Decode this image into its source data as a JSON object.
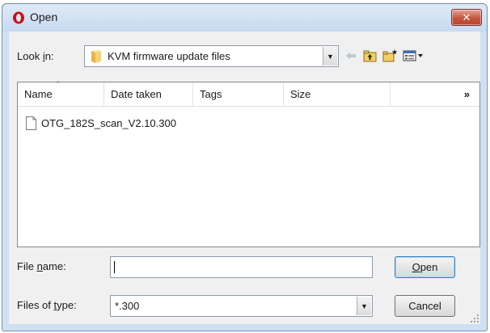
{
  "window": {
    "title": "Open",
    "close_glyph": "✕",
    "app_icon": "opera-logo-icon",
    "colors": {
      "title_bg": "#cfe0f3",
      "close_bg": "#c6553f",
      "accent_logo": "#cc0f16"
    }
  },
  "lookin": {
    "label_pre": "Look ",
    "label_u": "i",
    "label_post": "n:",
    "value": "KVM firmware update files",
    "icon": "folder-icon"
  },
  "toolbar": {
    "back_icon": "back-arrow-icon",
    "up_icon": "up-folder-icon",
    "new_folder_icon": "new-folder-icon",
    "view_menu_icon": "view-menu-icon"
  },
  "columns": [
    "Name",
    "Date taken",
    "Tags",
    "Size"
  ],
  "more_columns_glyph": "»",
  "files": [
    {
      "name": "OTG_182S_scan_V2.10.300",
      "icon": "file-icon"
    }
  ],
  "filename": {
    "label_pre": "File ",
    "label_u": "n",
    "label_post": "ame:",
    "value": "",
    "placeholder": ""
  },
  "filetype": {
    "label_pre": "Files of ",
    "label_u": "t",
    "label_post": "ype:",
    "value": "*.300"
  },
  "buttons": {
    "open_u": "O",
    "open_rest": "pen",
    "cancel": "Cancel"
  }
}
